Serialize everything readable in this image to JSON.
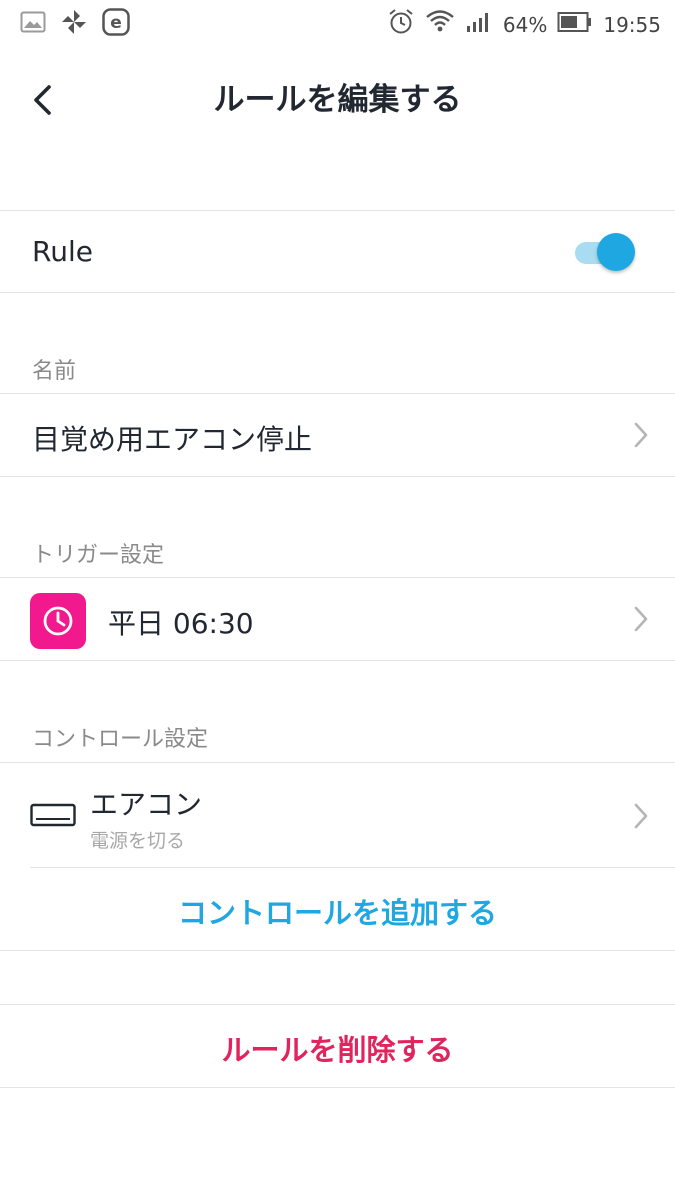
{
  "status_bar": {
    "battery_percent": "64%",
    "time": "19:55",
    "left_icons": [
      "image-icon",
      "pinwheel-icon",
      "e-badge-icon"
    ],
    "right_icons": [
      "alarm-icon",
      "wifi-icon",
      "signal-icon",
      "battery-icon"
    ]
  },
  "header": {
    "title": "ルールを編集する"
  },
  "rule_toggle": {
    "label": "Rule",
    "enabled": true,
    "accent_color": "#1ea7e1"
  },
  "name_section": {
    "label": "名前",
    "value": "目覚め用エアコン停止"
  },
  "trigger_section": {
    "label": "トリガー設定",
    "trigger_text": "平日 06:30",
    "icon": "clock-icon",
    "icon_color": "#f2188e"
  },
  "control_section": {
    "label": "コントロール設定",
    "device_name": "エアコン",
    "device_action": "電源を切る",
    "icon": "air-conditioner-icon",
    "add_control_label": "コントロールを追加する",
    "add_control_color": "#1ea7e1"
  },
  "delete": {
    "label": "ルールを削除する",
    "color": "#e0245e"
  }
}
